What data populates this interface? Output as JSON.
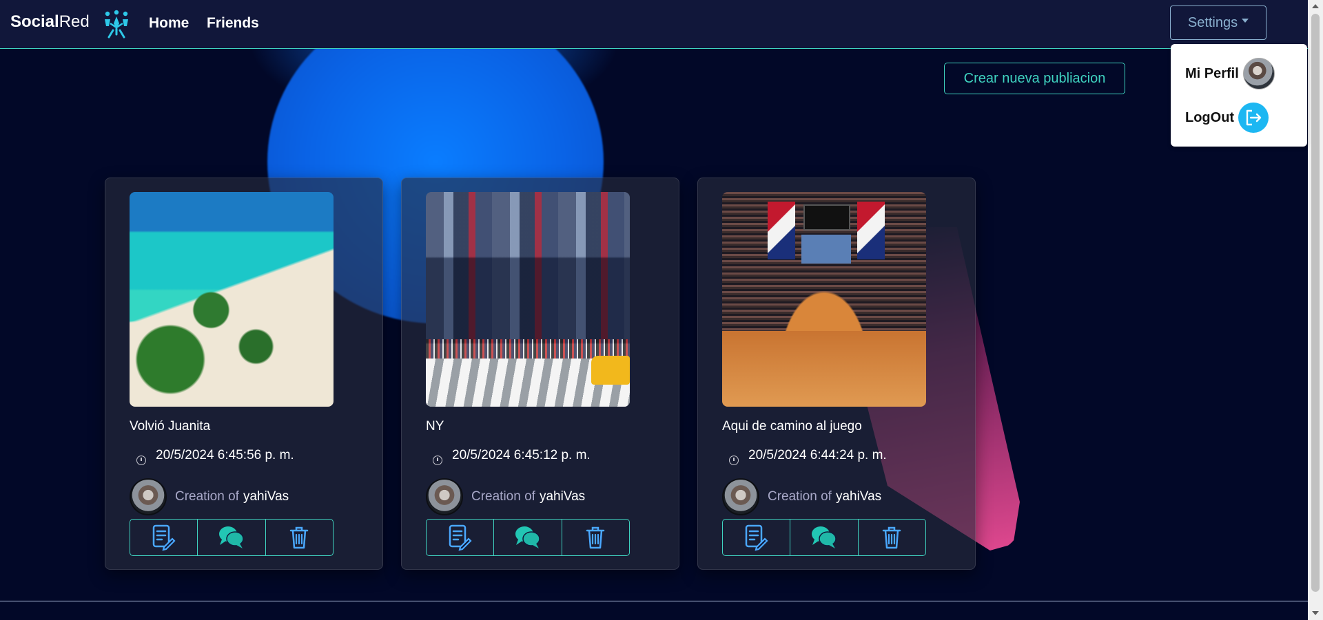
{
  "navbar": {
    "brand_bold": "Social",
    "brand_light": "Red",
    "links": [
      {
        "label": "Home"
      },
      {
        "label": "Friends"
      }
    ],
    "settings_label": "Settings"
  },
  "dropdown": {
    "profile_label": "Mi Perfil",
    "logout_label": "LogOut"
  },
  "create_post_label": "Crear nueva publiacion",
  "posts": [
    {
      "title": "Volvió Juanita",
      "date": "20/5/2024 6:45:56 p. m.",
      "creation_label": "Creation of",
      "author": "yahiVas"
    },
    {
      "title": "NY",
      "date": "20/5/2024 6:45:12 p. m.",
      "creation_label": "Creation of",
      "author": "yahiVas"
    },
    {
      "title": "Aqui de camino al juego",
      "date": "20/5/2024 6:44:24 p. m.",
      "creation_label": "Creation of",
      "author": "yahiVas"
    }
  ],
  "post_actions": [
    "edit-icon",
    "comments-icon",
    "trash-icon"
  ],
  "colors": {
    "accent": "#3fd3c0",
    "navbar_bg": "#11173a",
    "page_bg": "#020828",
    "icon_blue": "#4aa8ff",
    "icon_teal": "#22c6b4"
  }
}
